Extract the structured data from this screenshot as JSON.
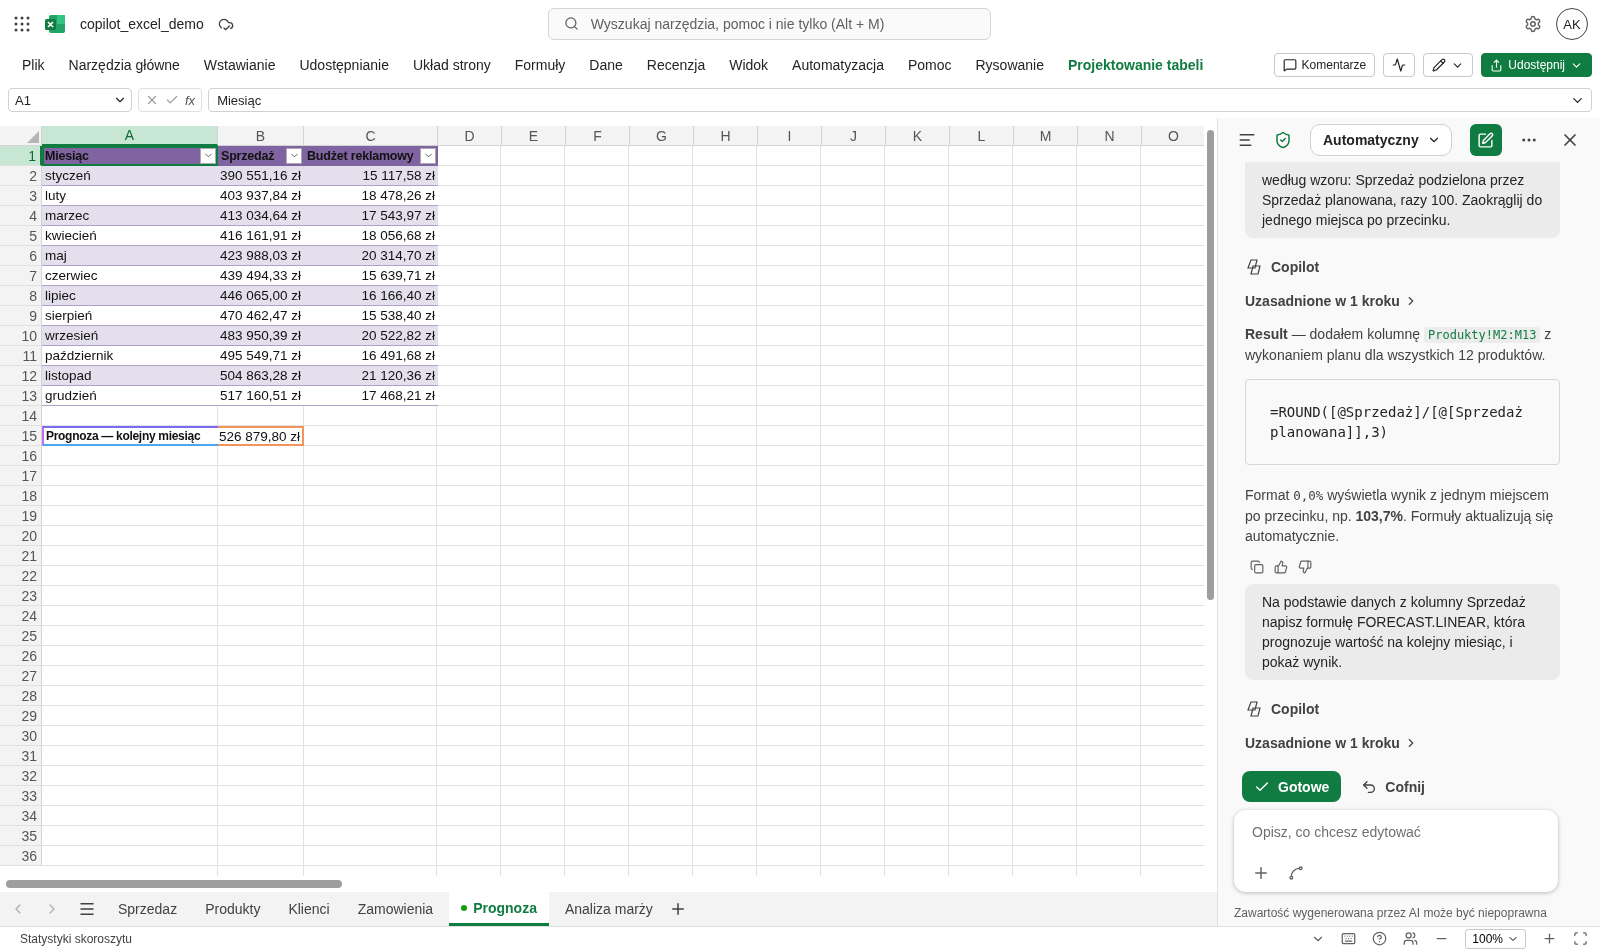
{
  "top_bar": {
    "file_name": "copilot_excel_demo",
    "search_placeholder": "Wyszukaj narzędzia, pomoc i nie tylko (Alt + M)",
    "avatar": "AK"
  },
  "ribbon": {
    "tabs": [
      {
        "label": "Plik",
        "kind": "normal"
      },
      {
        "label": "Narzędzia główne",
        "kind": "normal"
      },
      {
        "label": "Wstawianie",
        "kind": "normal"
      },
      {
        "label": "Udostępnianie",
        "kind": "normal"
      },
      {
        "label": "Układ strony",
        "kind": "normal"
      },
      {
        "label": "Formuły",
        "kind": "normal"
      },
      {
        "label": "Dane",
        "kind": "normal"
      },
      {
        "label": "Recenzja",
        "kind": "normal"
      },
      {
        "label": "Widok",
        "kind": "normal"
      },
      {
        "label": "Automatyzacja",
        "kind": "normal"
      },
      {
        "label": "Pomoc",
        "kind": "normal"
      },
      {
        "label": "Rysowanie",
        "kind": "normal"
      },
      {
        "label": "Projektowanie tabeli",
        "kind": "contextual"
      }
    ],
    "comments_button": "Komentarze",
    "share_button": "Udostępnij"
  },
  "formula_bar": {
    "name_box": "A1",
    "function_label": "fx",
    "formula": "Miesiąc"
  },
  "sheet": {
    "columns": [
      {
        "label": "A",
        "selected": true
      },
      {
        "label": "B",
        "selected": false
      },
      {
        "label": "C",
        "selected": false
      },
      {
        "label": "D",
        "selected": false
      },
      {
        "label": "E",
        "selected": false
      },
      {
        "label": "F",
        "selected": false
      },
      {
        "label": "G",
        "selected": false
      },
      {
        "label": "H",
        "selected": false
      },
      {
        "label": "I",
        "selected": false
      },
      {
        "label": "J",
        "selected": false
      },
      {
        "label": "K",
        "selected": false
      },
      {
        "label": "L",
        "selected": false
      },
      {
        "label": "M",
        "selected": false
      },
      {
        "label": "N",
        "selected": false
      },
      {
        "label": "O",
        "selected": false
      }
    ],
    "rows": [
      {
        "label": "1",
        "selected": true
      },
      {
        "label": "2",
        "selected": false
      },
      {
        "label": "3",
        "selected": false
      },
      {
        "label": "4",
        "selected": false
      },
      {
        "label": "5",
        "selected": false
      },
      {
        "label": "6",
        "selected": false
      },
      {
        "label": "7",
        "selected": false
      },
      {
        "label": "8",
        "selected": false
      },
      {
        "label": "9",
        "selected": false
      },
      {
        "label": "10",
        "selected": false
      },
      {
        "label": "11",
        "selected": false
      },
      {
        "label": "12",
        "selected": false
      },
      {
        "label": "13",
        "selected": false
      },
      {
        "label": "14",
        "selected": false
      },
      {
        "label": "15",
        "selected": false
      },
      {
        "label": "16",
        "selected": false
      },
      {
        "label": "17",
        "selected": false
      },
      {
        "label": "18",
        "selected": false
      },
      {
        "label": "19",
        "selected": false
      },
      {
        "label": "20",
        "selected": false
      },
      {
        "label": "21",
        "selected": false
      },
      {
        "label": "22",
        "selected": false
      },
      {
        "label": "23",
        "selected": false
      },
      {
        "label": "24",
        "selected": false
      },
      {
        "label": "25",
        "selected": false
      },
      {
        "label": "26",
        "selected": false
      },
      {
        "label": "27",
        "selected": false
      },
      {
        "label": "28",
        "selected": false
      },
      {
        "label": "29",
        "selected": false
      },
      {
        "label": "30",
        "selected": false
      },
      {
        "label": "31",
        "selected": false
      },
      {
        "label": "32",
        "selected": false
      },
      {
        "label": "33",
        "selected": false
      },
      {
        "label": "34",
        "selected": false
      },
      {
        "label": "35",
        "selected": false
      },
      {
        "label": "36",
        "selected": false
      }
    ],
    "table": {
      "columns": [
        "Miesiąc",
        "Sprzedaż",
        "Budżet reklamowy"
      ],
      "rows": [
        [
          "styczeń",
          "390 551,16 zł",
          "15 117,58 zł"
        ],
        [
          "luty",
          "403 937,84 zł",
          "18 478,26 zł"
        ],
        [
          "marzec",
          "413 034,64 zł",
          "17 543,97 zł"
        ],
        [
          "kwiecień",
          "416 161,91 zł",
          "18 056,68 zł"
        ],
        [
          "maj",
          "423 988,03 zł",
          "20 314,70 zł"
        ],
        [
          "czerwiec",
          "439 494,33 zł",
          "15 639,71 zł"
        ],
        [
          "lipiec",
          "446 065,00 zł",
          "16 166,40 zł"
        ],
        [
          "sierpień",
          "470 462,47 zł",
          "15 538,40 zł"
        ],
        [
          "wrzesień",
          "483 950,39 zł",
          "20 522,82 zł"
        ],
        [
          "październik",
          "495 549,71 zł",
          "16 491,68 zł"
        ],
        [
          "listopad",
          "504 863,28 zł",
          "21 120,36 zł"
        ],
        [
          "grudzień",
          "517 160,51 zł",
          "17 468,21 zł"
        ]
      ]
    },
    "forecast": {
      "label": "Prognoza — kolejny miesiąc",
      "value": "526 879,80 zł"
    }
  },
  "sheet_tabs": [
    {
      "label": "Sprzedaz",
      "selected": false
    },
    {
      "label": "Produkty",
      "selected": false
    },
    {
      "label": "Klienci",
      "selected": false
    },
    {
      "label": "Zamowienia",
      "selected": false
    },
    {
      "label": "Prognoza",
      "selected": true
    },
    {
      "label": "Analiza marży",
      "selected": false
    }
  ],
  "copilot": {
    "mode": "Automatyczny",
    "messages": [
      {
        "kind": "user",
        "text": "według wzoru: Sprzedaż podzielona przez Sprzedaż planowana, razy 100. Zaokrąglij do jednego miejsca po przecinku.",
        "cut": true
      },
      {
        "kind": "author",
        "text": "Copilot"
      },
      {
        "kind": "reasoning",
        "text": "Uzasadnione w 1 kroku"
      },
      {
        "kind": "paragraph",
        "parts": [
          {
            "kind": "bold",
            "text": "Result"
          },
          {
            "kind": "plain",
            "text": " — dodałem kolumnę "
          },
          {
            "kind": "code",
            "text": "Produkty!M2:M13"
          },
          {
            "kind": "plain",
            "text": " z wykonaniem planu dla wszystkich 12 produktów."
          }
        ]
      },
      {
        "kind": "code",
        "text": "=ROUND([@Sprzedaż]/[@[Sprzedaż planowana]],3)"
      },
      {
        "kind": "paragraph",
        "parts": [
          {
            "kind": "plain",
            "text": "Format "
          },
          {
            "kind": "mono",
            "text": "0,0%"
          },
          {
            "kind": "plain",
            "text": " wyświetla wynik z jednym miejscem po przecinku, np. "
          },
          {
            "kind": "bold",
            "text": "103,7%"
          },
          {
            "kind": "plain",
            "text": ". Formuły aktualizują się automatycznie."
          }
        ]
      },
      {
        "kind": "feedback"
      },
      {
        "kind": "user",
        "text": "Na podstawie danych z kolumny Sprzedaż napisz formułę FORECAST.LINEAR, która prognozuje wartość na kolejny miesiąc, i pokaż wynik.",
        "cut": false
      },
      {
        "kind": "author",
        "text": "Copilot"
      },
      {
        "kind": "reasoning",
        "text": "Uzasadnione w 1 kroku"
      }
    ],
    "actions": {
      "done": "Gotowe",
      "undo": "Cofnij"
    },
    "input_placeholder": "Opisz, co chcesz edytować",
    "disclaimer": "Zawartość wygenerowana przez AI może być niepoprawna"
  },
  "status_bar": {
    "text": "Statystyki skoroszytu",
    "zoom": "100%"
  }
}
